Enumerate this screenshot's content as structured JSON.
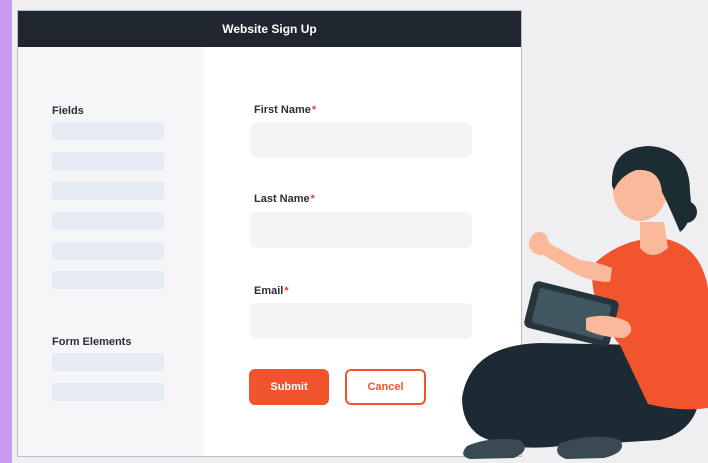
{
  "window": {
    "title": "Website Sign Up"
  },
  "sidebar": {
    "fields_title": "Fields",
    "form_elements_title": "Form Elements"
  },
  "form": {
    "first_name_label": "First Name",
    "last_name_label": "Last Name",
    "email_label": "Email",
    "required_mark": "*",
    "first_name_value": "",
    "last_name_value": "",
    "email_value": ""
  },
  "buttons": {
    "submit": "Submit",
    "cancel": "Cancel"
  },
  "colors": {
    "titlebar": "#1f2630",
    "accent": "#f0542e",
    "sidebar_bg": "#f4f6f8",
    "side_strip": "#c99af2"
  }
}
